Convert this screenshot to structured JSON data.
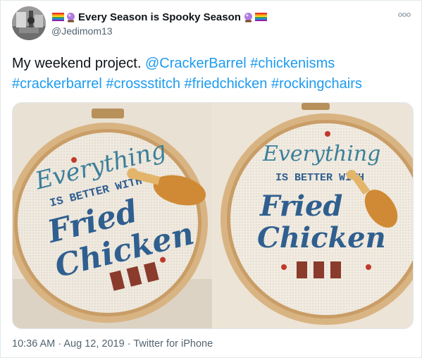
{
  "tweet": {
    "display_name": "Every Season is Spooky Season",
    "handle": "@Jedimom13",
    "text_intro": "My weekend project.",
    "mention": "@CrackerBarrel",
    "hashtags": [
      "#chickenisms",
      "#crackerbarrel",
      "#crossstitch",
      "#friedchicken",
      "#rockingchairs"
    ],
    "time": "10:36 AM",
    "separator": "·",
    "date": "Aug 12, 2019",
    "source": "Twitter for iPhone"
  },
  "media": {
    "photos": [
      {
        "stitch_line1": "Everything",
        "stitch_line2": "IS BETTER WITH",
        "stitch_line3": "Fried",
        "stitch_line4": "Chicken"
      },
      {
        "stitch_line1": "Everything",
        "stitch_line2": "IS BETTER WITH",
        "stitch_line3": "Fried",
        "stitch_line4": "Chicken"
      }
    ]
  },
  "icons": {
    "more": "more-dots-icon",
    "rainbow_flag": "rainbow-flag-icon",
    "crystal_ball": "crystal-ball-icon"
  },
  "colors": {
    "link": "#1d9bf0",
    "secondary_text": "#536471",
    "stitch_blue": "#2f5f8f",
    "stitch_teal": "#3b7f9a",
    "chicken_orange": "#d08a35",
    "hoop_wood": "#d9b483"
  }
}
